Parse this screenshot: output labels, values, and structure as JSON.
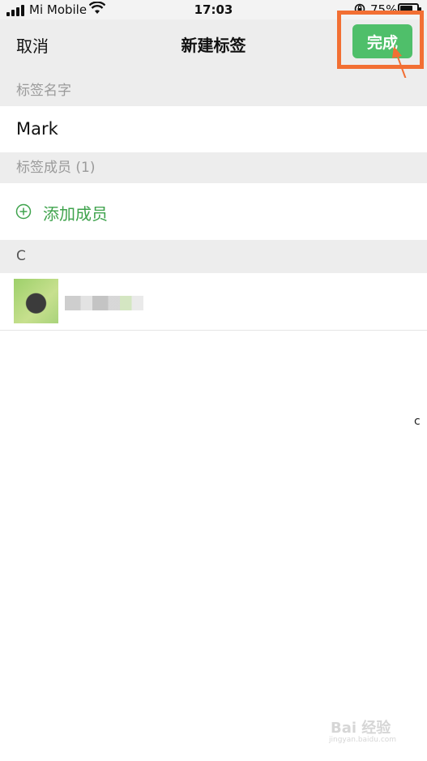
{
  "status_bar": {
    "carrier": "Mi Mobile",
    "time": "17:03",
    "battery_percent": "75%",
    "battery_level": 0.75
  },
  "nav": {
    "cancel_label": "取消",
    "title": "新建标签",
    "done_label": "完成",
    "done_color": "#4fbf6a",
    "highlight_color": "#f26f33"
  },
  "tag_name": {
    "header": "标签名字",
    "value": "Mark"
  },
  "members": {
    "header": "标签成员 (1)",
    "add_label": "添加成员",
    "accent_color": "#3fa34d"
  },
  "contacts": {
    "section_letter": "C",
    "index_letter": "c"
  },
  "watermark": {
    "text": "Bai 经验",
    "url": "jingyan.baidu.com"
  }
}
